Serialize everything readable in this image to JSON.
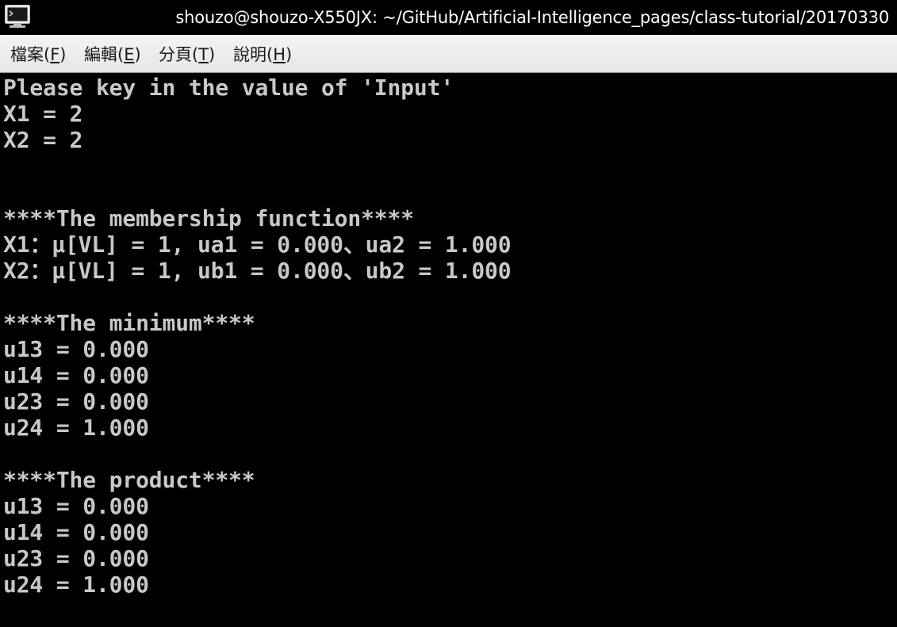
{
  "window": {
    "title": "shouzo@shouzo-X550JX: ~/GitHub/Artificial-Intelligence_pages/class-tutorial/20170330"
  },
  "menu": [
    {
      "label": "檔案(",
      "mnemonic": "F",
      "suffix": ")"
    },
    {
      "label": "編輯(",
      "mnemonic": "E",
      "suffix": ")"
    },
    {
      "label": "分頁(",
      "mnemonic": "T",
      "suffix": ")"
    },
    {
      "label": "說明(",
      "mnemonic": "H",
      "suffix": ")"
    }
  ],
  "terminal": {
    "lines": [
      "Please key in the value of 'Input'",
      "X1 = 2",
      "X2 = 2",
      "",
      "",
      "****The membership function****",
      "X1：μ[VL] = 1, ua1 = 0.000、ua2 = 1.000",
      "X2：μ[VL] = 1, ub1 = 0.000、ub2 = 1.000",
      "",
      "****The minimum****",
      "u13 = 0.000",
      "u14 = 0.000",
      "u23 = 0.000",
      "u24 = 1.000",
      "",
      "****The product****",
      "u13 = 0.000",
      "u14 = 0.000",
      "u23 = 0.000",
      "u24 = 1.000"
    ]
  },
  "colors": {
    "terminal_bg": "#000000",
    "terminal_fg": "#c8c8c8",
    "menubar_bg": "#ececec"
  },
  "icons": {
    "app": "terminal-icon"
  }
}
